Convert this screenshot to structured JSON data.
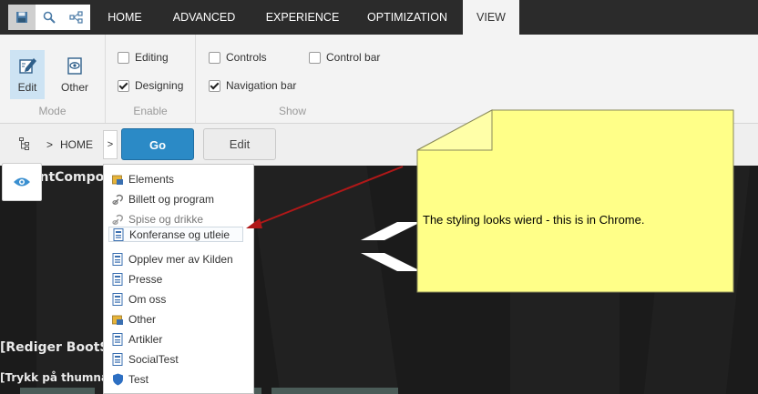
{
  "topbar": {
    "quick_access": [
      {
        "icon": "save-icon"
      },
      {
        "icon": "search-icon"
      },
      {
        "icon": "share-icon"
      }
    ],
    "tabs": [
      {
        "label": "HOME",
        "active": false
      },
      {
        "label": "ADVANCED",
        "active": false
      },
      {
        "label": "EXPERIENCE",
        "active": false
      },
      {
        "label": "OPTIMIZATION",
        "active": false
      },
      {
        "label": "VIEW",
        "active": true
      }
    ]
  },
  "ribbon": {
    "mode": {
      "title": "Mode",
      "buttons": [
        {
          "label": "Edit",
          "icon": "pencil-icon",
          "active": true
        },
        {
          "label": "Other",
          "icon": "eye-icon",
          "active": false
        }
      ]
    },
    "enable": {
      "title": "Enable",
      "options": [
        {
          "label": "Editing",
          "checked": false
        },
        {
          "label": "Designing",
          "checked": true
        }
      ]
    },
    "show": {
      "title": "Show",
      "options": [
        {
          "label": "Controls",
          "checked": false
        },
        {
          "label": "Control bar",
          "checked": false
        },
        {
          "label": "Navigation bar",
          "checked": true
        }
      ]
    }
  },
  "navbar": {
    "tree_icon": "tree-icon",
    "crumb": "HOME",
    "crumb_separator": ">",
    "chevron": ">",
    "go_label": "Go",
    "edit_label": "Edit"
  },
  "dropdown": {
    "items": [
      {
        "label": "Elements",
        "icon": "folder-lock-icon",
        "style": "normal"
      },
      {
        "label": "Billett og program",
        "icon": "link-icon",
        "style": "normal"
      },
      {
        "label": "Spise og drikke",
        "icon": "link-icon",
        "style": "dim"
      },
      {
        "label": "Konferanse og utleie",
        "icon": "page-icon",
        "style": "highlight"
      },
      {
        "label": "Opplev mer av Kilden",
        "icon": "page-icon",
        "style": "normal"
      },
      {
        "label": "Presse",
        "icon": "page-icon",
        "style": "normal"
      },
      {
        "label": "Om oss",
        "icon": "page-icon",
        "style": "normal"
      },
      {
        "label": "Other",
        "icon": "folder-lock-icon",
        "style": "normal"
      },
      {
        "label": "Artikler",
        "icon": "page-icon",
        "style": "normal"
      },
      {
        "label": "SocialTest",
        "icon": "page-icon",
        "style": "normal"
      },
      {
        "label": "Test",
        "icon": "shield-icon",
        "style": "normal"
      }
    ]
  },
  "page": {
    "heading": "entCompo",
    "rediger": "[Rediger BootSt",
    "trykk": "[Trykk på thumnai"
  },
  "note": {
    "text": "The styling looks wierd - this is in Chrome."
  },
  "colors": {
    "accent": "#2b8ac6",
    "note": "#ffff88",
    "arrow": "#b01818"
  }
}
